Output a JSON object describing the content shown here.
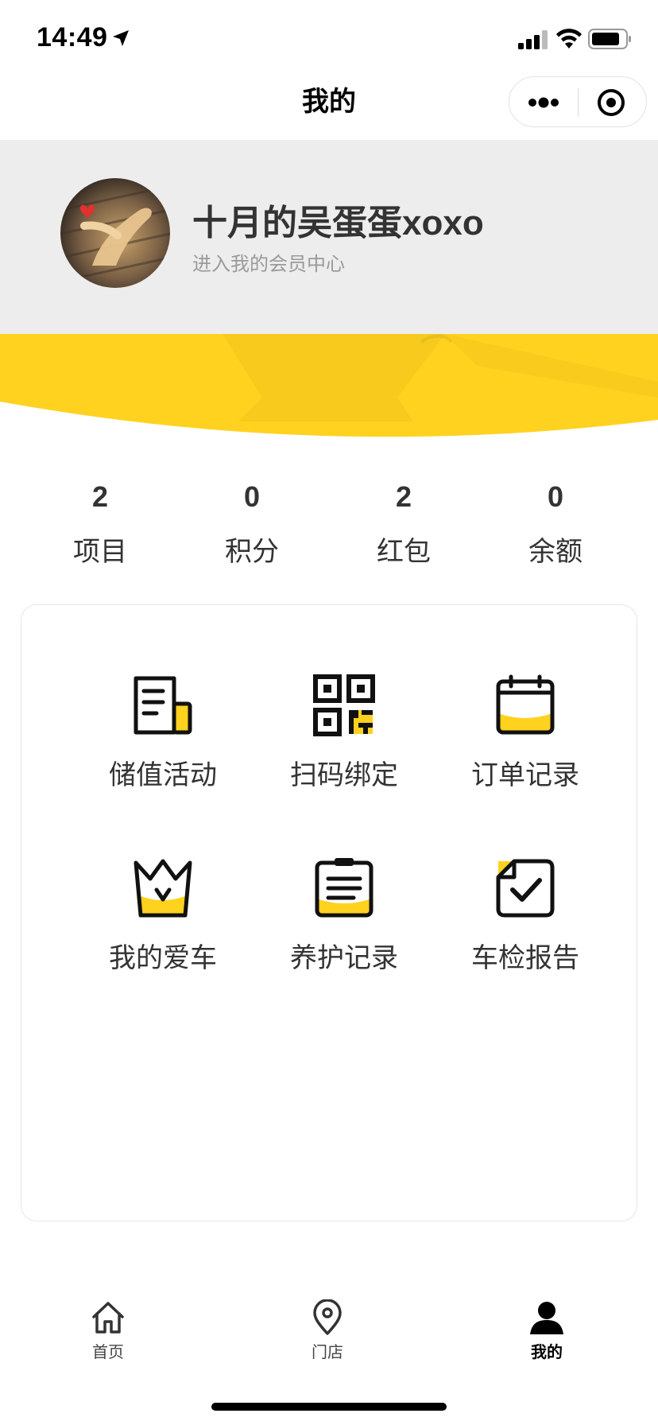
{
  "status_bar": {
    "time": "14:49"
  },
  "nav": {
    "title": "我的"
  },
  "profile": {
    "user_name": "十月的吴蛋蛋xoxo",
    "member_center_link": "进入我的会员中心"
  },
  "stats": [
    {
      "value": "2",
      "label": "项目"
    },
    {
      "value": "0",
      "label": "积分"
    },
    {
      "value": "2",
      "label": "红包"
    },
    {
      "value": "0",
      "label": "余额"
    }
  ],
  "grid": [
    {
      "label": "储值活动",
      "icon": "document-icon"
    },
    {
      "label": "扫码绑定",
      "icon": "qrcode-icon"
    },
    {
      "label": "订单记录",
      "icon": "calendar-icon"
    },
    {
      "label": "我的爱车",
      "icon": "crown-icon"
    },
    {
      "label": "养护记录",
      "icon": "clipboard-icon"
    },
    {
      "label": "车检报告",
      "icon": "check-note-icon"
    }
  ],
  "tab_bar": [
    {
      "label": "首页",
      "icon": "home-icon"
    },
    {
      "label": "门店",
      "icon": "location-icon"
    },
    {
      "label": "我的",
      "icon": "user-icon",
      "active": true
    }
  ],
  "colors": {
    "accent_yellow": "#FFD21F",
    "header_gray": "#EDEDED"
  }
}
